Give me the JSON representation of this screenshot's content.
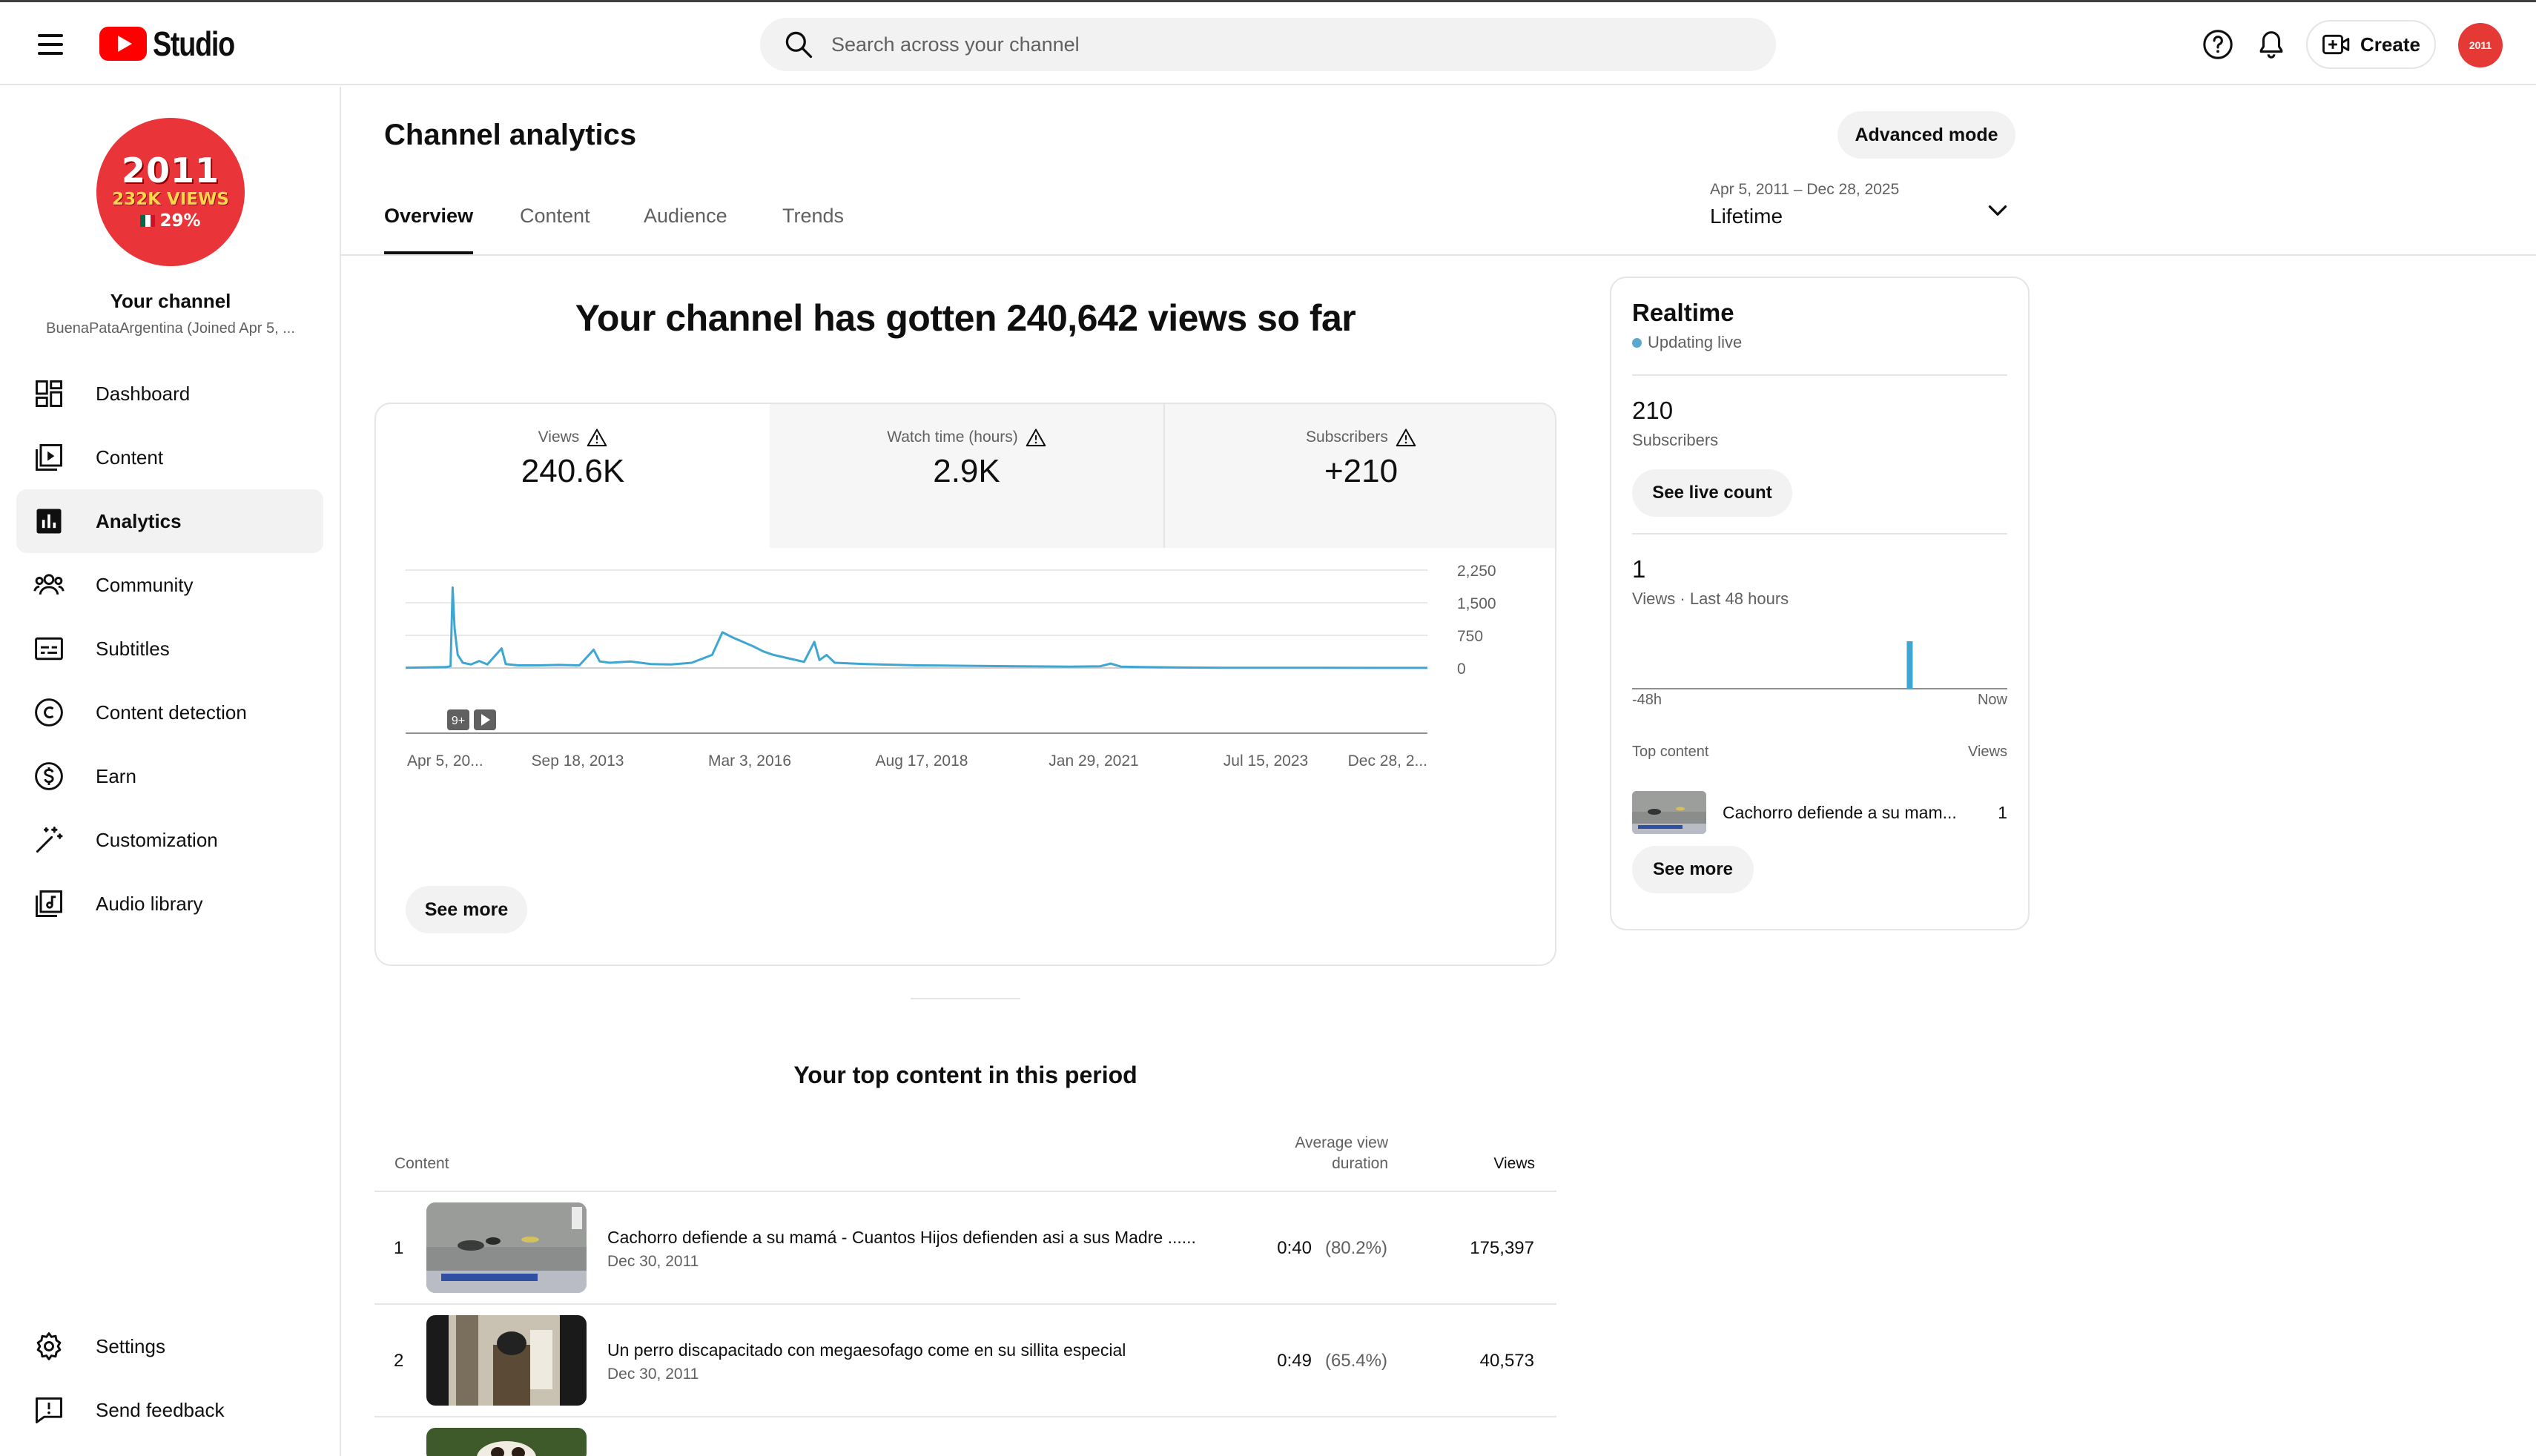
{
  "header": {
    "logo_text": "Studio",
    "search_placeholder": "Search across your channel",
    "create_label": "Create"
  },
  "sidebar": {
    "avatar": {
      "year": "2011",
      "views": "232K VIEWS",
      "pct": "29%"
    },
    "channel_title": "Your channel",
    "channel_subtitle": "BuenaPataArgentina (Joined Apr 5, ...",
    "items": [
      {
        "label": "Dashboard",
        "icon": "dashboard-icon"
      },
      {
        "label": "Content",
        "icon": "content-icon"
      },
      {
        "label": "Analytics",
        "icon": "analytics-icon"
      },
      {
        "label": "Community",
        "icon": "community-icon"
      },
      {
        "label": "Subtitles",
        "icon": "subtitles-icon"
      },
      {
        "label": "Content detection",
        "icon": "copyright-icon"
      },
      {
        "label": "Earn",
        "icon": "earn-icon"
      },
      {
        "label": "Customization",
        "icon": "customization-icon"
      },
      {
        "label": "Audio library",
        "icon": "audio-library-icon"
      }
    ],
    "bottom_items": [
      {
        "label": "Settings",
        "icon": "gear-icon"
      },
      {
        "label": "Send feedback",
        "icon": "feedback-icon"
      }
    ],
    "active_index": 2
  },
  "main": {
    "title": "Channel analytics",
    "advanced_label": "Advanced mode",
    "tabs": [
      "Overview",
      "Content",
      "Audience",
      "Trends"
    ],
    "active_tab": 0,
    "date_range": "Apr 5, 2011 – Dec 28, 2025",
    "date_label": "Lifetime",
    "headline": "Your channel has gotten 240,642 views so far",
    "metrics": [
      {
        "label": "Views",
        "value": "240.6K"
      },
      {
        "label": "Watch time (hours)",
        "value": "2.9K"
      },
      {
        "label": "Subscribers",
        "value": "+210"
      }
    ],
    "chart_badge": "9+",
    "see_more_label": "See more",
    "top_content": {
      "title": "Your top content in this period",
      "col_content": "Content",
      "col_avd": "Average view duration",
      "col_avd_line1": "Average view",
      "col_avd_line2": "duration",
      "col_views": "Views",
      "rows": [
        {
          "num": "1",
          "title": "Cachorro defiende a su mamá - Cuantos Hijos defienden asi a sus Madre ......",
          "date": "Dec 30, 2011",
          "duration": "0:40",
          "pct": "(80.2%)",
          "views": "175,397"
        },
        {
          "num": "2",
          "title": "Un perro discapacitado con megaesofago come en su sillita especial",
          "date": "Dec 30, 2011",
          "duration": "0:49",
          "pct": "(65.4%)",
          "views": "40,573"
        }
      ]
    }
  },
  "chart_data": {
    "type": "line",
    "x_tick_labels": [
      "Apr 5, 20...",
      "Sep 18, 2013",
      "Mar 3, 2016",
      "Aug 17, 2018",
      "Jan 29, 2021",
      "Jul 15, 2023",
      "Dec 28, 2..."
    ],
    "y_ticks": [
      0,
      750,
      1500,
      2250
    ],
    "y_tick_labels": [
      "0",
      "750",
      "1,500",
      "2,250"
    ],
    "ylim": [
      0,
      2250
    ],
    "grid": true,
    "series": [
      {
        "color": "#3ea6d1",
        "x_range": [
          "2011-04-05",
          "2025-12-28"
        ],
        "points": [
          [
            0.0,
            5
          ],
          [
            0.04,
            20
          ],
          [
            0.044,
            40
          ],
          [
            0.046,
            1850
          ],
          [
            0.048,
            900
          ],
          [
            0.051,
            300
          ],
          [
            0.056,
            120
          ],
          [
            0.064,
            80
          ],
          [
            0.072,
            160
          ],
          [
            0.08,
            80
          ],
          [
            0.094,
            450
          ],
          [
            0.098,
            90
          ],
          [
            0.11,
            60
          ],
          [
            0.13,
            60
          ],
          [
            0.15,
            70
          ],
          [
            0.17,
            60
          ],
          [
            0.184,
            420
          ],
          [
            0.19,
            150
          ],
          [
            0.2,
            120
          ],
          [
            0.22,
            150
          ],
          [
            0.24,
            90
          ],
          [
            0.26,
            80
          ],
          [
            0.28,
            120
          ],
          [
            0.3,
            300
          ],
          [
            0.31,
            820
          ],
          [
            0.32,
            700
          ],
          [
            0.33,
            600
          ],
          [
            0.34,
            500
          ],
          [
            0.35,
            380
          ],
          [
            0.36,
            300
          ],
          [
            0.375,
            220
          ],
          [
            0.39,
            140
          ],
          [
            0.4,
            600
          ],
          [
            0.405,
            180
          ],
          [
            0.412,
            300
          ],
          [
            0.42,
            120
          ],
          [
            0.45,
            90
          ],
          [
            0.5,
            60
          ],
          [
            0.55,
            50
          ],
          [
            0.6,
            40
          ],
          [
            0.65,
            30
          ],
          [
            0.68,
            40
          ],
          [
            0.69,
            100
          ],
          [
            0.7,
            30
          ],
          [
            0.72,
            20
          ],
          [
            0.76,
            10
          ],
          [
            0.8,
            5
          ],
          [
            0.85,
            4
          ],
          [
            0.9,
            3
          ],
          [
            0.95,
            2
          ],
          [
            1.0,
            2
          ]
        ]
      }
    ]
  },
  "realtime": {
    "title": "Realtime",
    "live_label": "Updating live",
    "subscribers_value": "210",
    "subscribers_label": "Subscribers",
    "live_count_label": "See live count",
    "views_value": "1",
    "views_label": "Views · Last 48 hours",
    "axis_left": "-48h",
    "axis_right": "Now",
    "bar_position": 0.74,
    "top_content_label": "Top content",
    "views_col_label": "Views",
    "item_title": "Cachorro defiende a su mam...",
    "item_views": "1",
    "see_more_label": "See more"
  }
}
